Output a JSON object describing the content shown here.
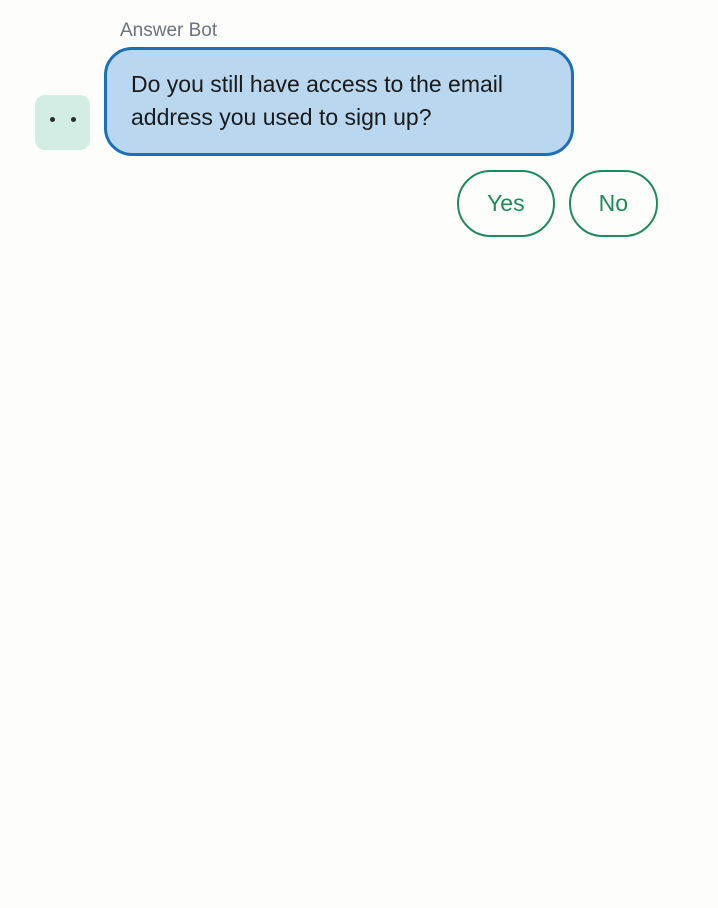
{
  "bot": {
    "name": "Answer Bot"
  },
  "message": {
    "text": "Do you still have access to the email address you used to sign up?"
  },
  "responses": {
    "yes": "Yes",
    "no": "No"
  }
}
